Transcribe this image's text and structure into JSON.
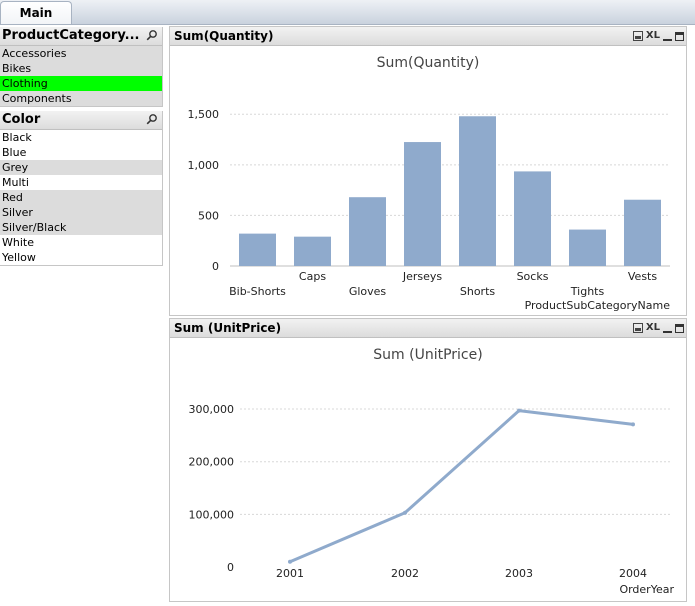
{
  "tabs": [
    {
      "label": "Main",
      "active": true
    }
  ],
  "listboxes": {
    "category": {
      "title": "ProductCategory...",
      "items": [
        {
          "label": "Accessories",
          "state": "excluded"
        },
        {
          "label": "Bikes",
          "state": "excluded"
        },
        {
          "label": "Clothing",
          "state": "selected"
        },
        {
          "label": "Components",
          "state": "excluded"
        }
      ]
    },
    "color": {
      "title": "Color",
      "items": [
        {
          "label": "Black",
          "state": "optional"
        },
        {
          "label": "Blue",
          "state": "optional"
        },
        {
          "label": "Grey",
          "state": "excluded"
        },
        {
          "label": "Multi",
          "state": "optional"
        },
        {
          "label": "Red",
          "state": "excluded"
        },
        {
          "label": "Silver",
          "state": "excluded"
        },
        {
          "label": "Silver/Black",
          "state": "excluded"
        },
        {
          "label": "White",
          "state": "optional"
        },
        {
          "label": "Yellow",
          "state": "optional"
        }
      ]
    }
  },
  "panels": {
    "quantity": {
      "caption": "Sum(Quantity)",
      "icon_xl": "XL"
    },
    "unitprice": {
      "caption": "Sum (UnitPrice)",
      "icon_xl": "XL"
    }
  },
  "colors": {
    "selected": "#00ff00",
    "excluded": "#dcdcdc",
    "series": "#8faacc"
  },
  "chart_data": [
    {
      "type": "bar",
      "title": "Sum(Quantity)",
      "xlabel": "ProductSubCategoryName",
      "ylabel": "",
      "categories": [
        "Bib-Shorts",
        "Caps",
        "Gloves",
        "Jerseys",
        "Shorts",
        "Socks",
        "Tights",
        "Vests"
      ],
      "values": [
        320,
        290,
        680,
        1225,
        1480,
        935,
        360,
        655
      ],
      "ylim": [
        0,
        1700
      ],
      "yticks": [
        0,
        500,
        1000,
        1500
      ],
      "ytick_labels": [
        "0",
        "500",
        "1,000",
        "1,500"
      ],
      "grid": true
    },
    {
      "type": "line",
      "title": "Sum (UnitPrice)",
      "xlabel": "OrderYear",
      "ylabel": "",
      "categories": [
        "2001",
        "2002",
        "2003",
        "2004"
      ],
      "values": [
        10000,
        103000,
        297000,
        271000
      ],
      "ylim": [
        0,
        340000
      ],
      "yticks": [
        0,
        100000,
        200000,
        300000
      ],
      "ytick_labels": [
        "0",
        "100,000",
        "200,000",
        "300,000"
      ],
      "grid": true
    }
  ]
}
